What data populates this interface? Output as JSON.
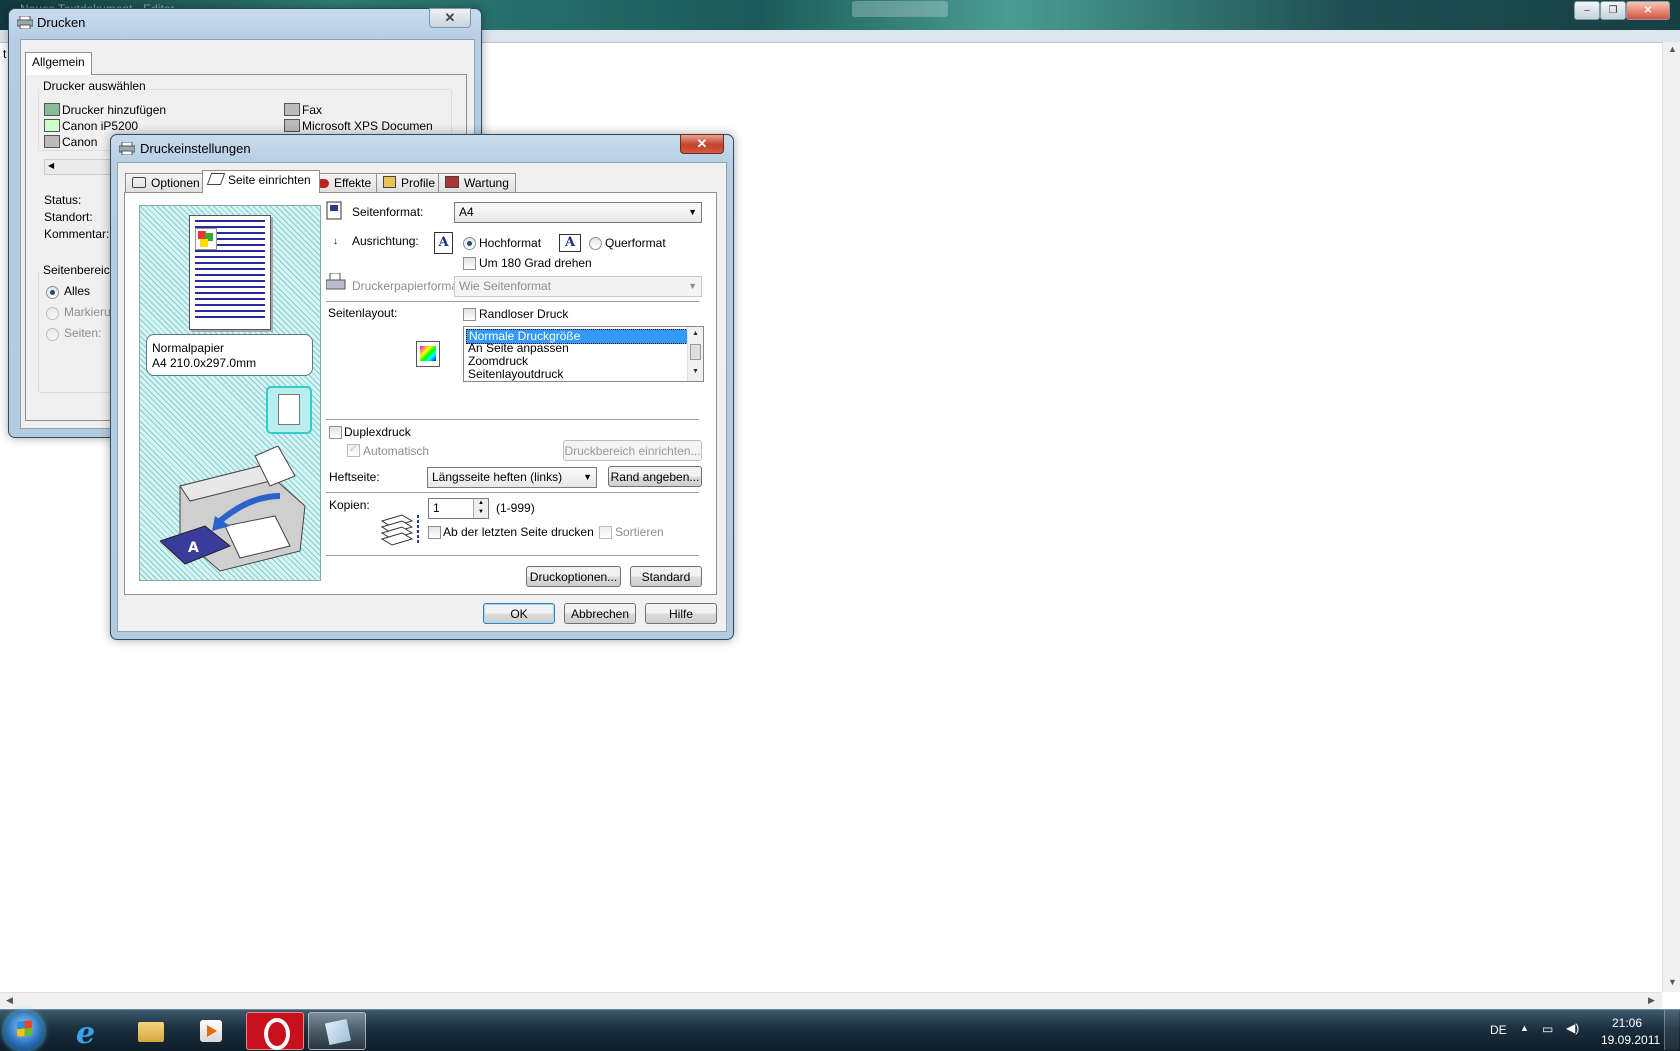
{
  "background_window": {
    "title": "Neues Textdokument - Editor",
    "left_char": "t"
  },
  "print_dialog": {
    "title": "Drucken",
    "tab": "Allgemein",
    "printer_group_label": "Drucker auswählen",
    "printers": [
      {
        "label": "Drucker hinzufügen"
      },
      {
        "label": "Fax"
      },
      {
        "label": "Canon iP5200"
      },
      {
        "label": "Microsoft XPS Documen"
      },
      {
        "label": "Canon"
      }
    ],
    "status_label": "Status:",
    "location_label": "Standort:",
    "comment_label": "Kommentar:",
    "page_range_label": "Seitenbereic",
    "range_all": "Alles",
    "range_selection": "Markierun",
    "range_pages": "Seiten:"
  },
  "settings_dialog": {
    "title": "Druckeinstellungen",
    "tabs": [
      "Optionen",
      "Seite einrichten",
      "Effekte",
      "Profile",
      "Wartung"
    ],
    "selected_tab": "Seite einrichten",
    "page_size_label": "Seitenformat:",
    "page_size_value": "A4",
    "orientation_label": "Ausrichtung:",
    "orientation_portrait": "Hochformat",
    "orientation_landscape": "Querformat",
    "rotate_180": "Um 180 Grad drehen",
    "printer_paper_label": "Druckerpapierformat:",
    "printer_paper_value": "Wie Seitenformat",
    "page_layout_label": "Seitenlayout:",
    "borderless": "Randloser Druck",
    "layout_options": [
      "Normale Druckgröße",
      "An Seite anpassen",
      "Zoomdruck",
      "Seitenlayoutdruck"
    ],
    "selected_layout": "Normale Druckgröße",
    "duplex": "Duplexdruck",
    "automatic": "Automatisch",
    "print_area_button": "Druckbereich einrichten...",
    "stapling_label": "Heftseite:",
    "stapling_value": "Längsseite heften (links)",
    "margin_button": "Rand angeben...",
    "copies_label": "Kopien:",
    "copies_value": "1",
    "copies_range": "(1-999)",
    "reverse_order": "Ab der letzten Seite drucken",
    "collate": "Sortieren",
    "print_options_button": "Druckoptionen...",
    "default_button": "Standard",
    "ok_button": "OK",
    "cancel_button": "Abbrechen",
    "help_button": "Hilfe",
    "paper_info_line1": "Normalpapier",
    "paper_info_line2": "A4 210.0x297.0mm",
    "colors": {
      "accent": "#3399ff",
      "preview_bg": "#7ed1d3",
      "text_lines": "#2a2aa0"
    }
  },
  "taskbar": {
    "language": "DE",
    "time": "21:06",
    "date": "19.09.2011",
    "icons": [
      "windows-start-icon",
      "internet-explorer-icon",
      "windows-explorer-icon",
      "media-player-icon",
      "opera-icon",
      "notepad-icon"
    ]
  }
}
